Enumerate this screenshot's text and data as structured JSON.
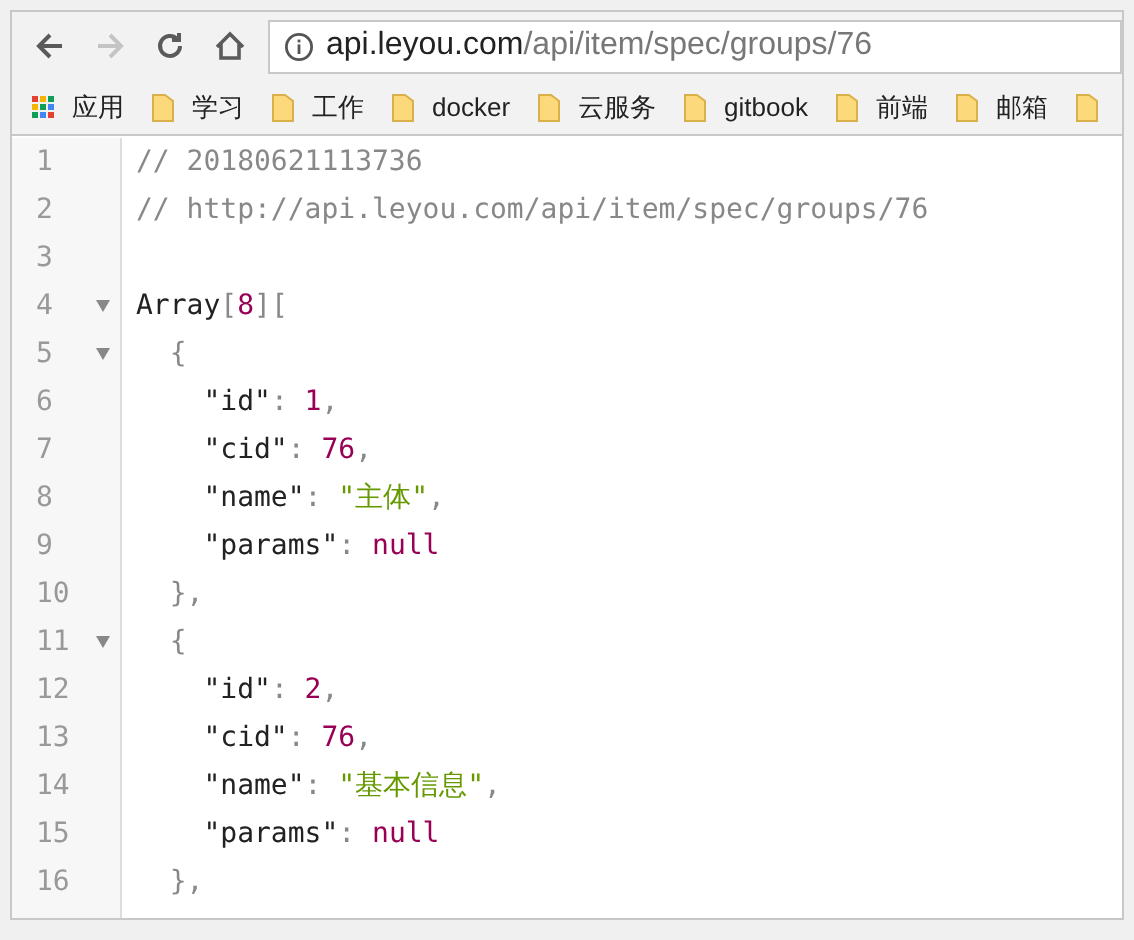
{
  "toolbar": {
    "buttons": [
      {
        "kind": "back",
        "disabled": false
      },
      {
        "kind": "forward",
        "disabled": true
      },
      {
        "kind": "reload",
        "disabled": false
      },
      {
        "kind": "home",
        "disabled": false
      }
    ],
    "address": {
      "host": "api.leyou.com",
      "path": "/api/item/spec/groups/76"
    }
  },
  "bookmarks": [
    {
      "kind": "apps",
      "label": "应用"
    },
    {
      "kind": "folder",
      "label": "学习"
    },
    {
      "kind": "folder",
      "label": "工作"
    },
    {
      "kind": "folder",
      "label": "docker"
    },
    {
      "kind": "folder",
      "label": "云服务"
    },
    {
      "kind": "folder",
      "label": "gitbook"
    },
    {
      "kind": "folder",
      "label": "前端"
    },
    {
      "kind": "folder",
      "label": "邮箱"
    },
    {
      "kind": "folder"
    }
  ],
  "code_lines": [
    {
      "number": "1",
      "foldable": false,
      "tokens": [
        {
          "kind": "comment",
          "text": "// 20180621113736"
        }
      ]
    },
    {
      "number": "2",
      "foldable": false,
      "tokens": [
        {
          "kind": "comment",
          "text": "// http://api.leyou.com/api/item/spec/groups/76"
        }
      ]
    },
    {
      "number": "3",
      "foldable": false
    },
    {
      "number": "4",
      "foldable": true,
      "tokens": [
        {
          "kind": "plain",
          "text": "Array"
        },
        {
          "kind": "punct",
          "text": "["
        },
        {
          "kind": "number",
          "text": "8"
        },
        {
          "kind": "punct",
          "text": "]["
        }
      ]
    },
    {
      "number": "5",
      "foldable": true,
      "tokens": [
        {
          "kind": "punct",
          "text": "  {"
        }
      ]
    },
    {
      "number": "6",
      "foldable": false,
      "tokens": [
        {
          "kind": "key",
          "text": "    \"id\""
        },
        {
          "kind": "punct",
          "text": ": "
        },
        {
          "kind": "number",
          "text": "1"
        },
        {
          "kind": "punct",
          "text": ","
        }
      ]
    },
    {
      "number": "7",
      "foldable": false,
      "tokens": [
        {
          "kind": "key",
          "text": "    \"cid\""
        },
        {
          "kind": "punct",
          "text": ": "
        },
        {
          "kind": "number",
          "text": "76"
        },
        {
          "kind": "punct",
          "text": ","
        }
      ]
    },
    {
      "number": "8",
      "foldable": false,
      "tokens": [
        {
          "kind": "key",
          "text": "    \"name\""
        },
        {
          "kind": "punct",
          "text": ": "
        },
        {
          "kind": "string",
          "text": "\"主体\""
        },
        {
          "kind": "punct",
          "text": ","
        }
      ]
    },
    {
      "number": "9",
      "foldable": false,
      "tokens": [
        {
          "kind": "key",
          "text": "    \"params\""
        },
        {
          "kind": "punct",
          "text": ": "
        },
        {
          "kind": "null",
          "text": "null"
        }
      ]
    },
    {
      "number": "10",
      "foldable": false,
      "tokens": [
        {
          "kind": "punct",
          "text": "  },"
        }
      ]
    },
    {
      "number": "11",
      "foldable": true,
      "tokens": [
        {
          "kind": "punct",
          "text": "  {"
        }
      ]
    },
    {
      "number": "12",
      "foldable": false,
      "tokens": [
        {
          "kind": "key",
          "text": "    \"id\""
        },
        {
          "kind": "punct",
          "text": ": "
        },
        {
          "kind": "number",
          "text": "2"
        },
        {
          "kind": "punct",
          "text": ","
        }
      ]
    },
    {
      "number": "13",
      "foldable": false,
      "tokens": [
        {
          "kind": "key",
          "text": "    \"cid\""
        },
        {
          "kind": "punct",
          "text": ": "
        },
        {
          "kind": "number",
          "text": "76"
        },
        {
          "kind": "punct",
          "text": ","
        }
      ]
    },
    {
      "number": "14",
      "foldable": false,
      "tokens": [
        {
          "kind": "key",
          "text": "    \"name\""
        },
        {
          "kind": "punct",
          "text": ": "
        },
        {
          "kind": "string",
          "text": "\"基本信息\""
        },
        {
          "kind": "punct",
          "text": ","
        }
      ]
    },
    {
      "number": "15",
      "foldable": false,
      "tokens": [
        {
          "kind": "key",
          "text": "    \"params\""
        },
        {
          "kind": "punct",
          "text": ": "
        },
        {
          "kind": "null",
          "text": "null"
        }
      ]
    },
    {
      "number": "16",
      "foldable": false,
      "tokens": [
        {
          "kind": "punct",
          "text": "  },"
        }
      ]
    }
  ]
}
